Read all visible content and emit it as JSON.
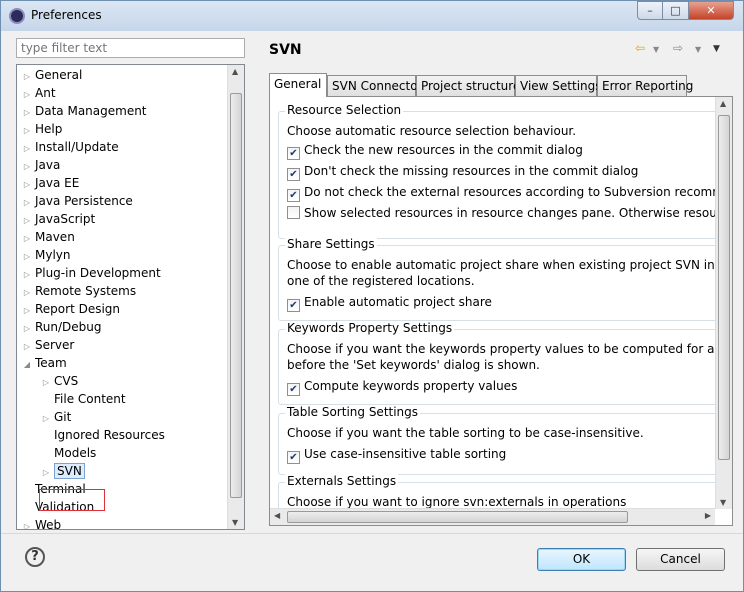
{
  "window": {
    "title": "Preferences",
    "min_label": "–",
    "max_label": "□",
    "close_label": "✕"
  },
  "filter": {
    "placeholder": "type filter text"
  },
  "tree": [
    {
      "label": "General",
      "level": 0,
      "expander": "collapsed"
    },
    {
      "label": "Ant",
      "level": 0,
      "expander": "collapsed"
    },
    {
      "label": "Data Management",
      "level": 0,
      "expander": "collapsed"
    },
    {
      "label": "Help",
      "level": 0,
      "expander": "collapsed"
    },
    {
      "label": "Install/Update",
      "level": 0,
      "expander": "collapsed"
    },
    {
      "label": "Java",
      "level": 0,
      "expander": "collapsed"
    },
    {
      "label": "Java EE",
      "level": 0,
      "expander": "collapsed"
    },
    {
      "label": "Java Persistence",
      "level": 0,
      "expander": "collapsed"
    },
    {
      "label": "JavaScript",
      "level": 0,
      "expander": "collapsed"
    },
    {
      "label": "Maven",
      "level": 0,
      "expander": "collapsed"
    },
    {
      "label": "Mylyn",
      "level": 0,
      "expander": "collapsed"
    },
    {
      "label": "Plug-in Development",
      "level": 0,
      "expander": "collapsed"
    },
    {
      "label": "Remote Systems",
      "level": 0,
      "expander": "collapsed"
    },
    {
      "label": "Report Design",
      "level": 0,
      "expander": "collapsed"
    },
    {
      "label": "Run/Debug",
      "level": 0,
      "expander": "collapsed"
    },
    {
      "label": "Server",
      "level": 0,
      "expander": "collapsed"
    },
    {
      "label": "Team",
      "level": 0,
      "expander": "expanded"
    },
    {
      "label": "CVS",
      "level": 1,
      "expander": "collapsed"
    },
    {
      "label": "File Content",
      "level": 1,
      "expander": "none"
    },
    {
      "label": "Git",
      "level": 1,
      "expander": "collapsed"
    },
    {
      "label": "Ignored Resources",
      "level": 1,
      "expander": "none"
    },
    {
      "label": "Models",
      "level": 1,
      "expander": "none"
    },
    {
      "label": "SVN",
      "level": 1,
      "expander": "collapsed",
      "selected": true
    },
    {
      "label": "Terminal",
      "level": 0,
      "expander": "none"
    },
    {
      "label": "Validation",
      "level": 0,
      "expander": "none"
    },
    {
      "label": "Web",
      "level": 0,
      "expander": "collapsed"
    }
  ],
  "page": {
    "title": "SVN"
  },
  "tabs": [
    "General",
    "SVN Connector",
    "Project structure",
    "View Settings",
    "Error Reporting"
  ],
  "general": {
    "resource_selection": {
      "title": "Resource Selection",
      "desc": "Choose automatic resource selection behaviour.",
      "options": [
        {
          "label": "Check the new resources in the commit dialog",
          "checked": true
        },
        {
          "label": "Don't check the missing resources in the commit dialog",
          "checked": true
        },
        {
          "label": "Do not check the external resources according to Subversion recommendation",
          "checked": true
        },
        {
          "label": "Show selected resources in resource changes pane. Otherwise resources are sho",
          "checked": false
        }
      ]
    },
    "share": {
      "title": "Share Settings",
      "desc1": "Choose to enable automatic project share when existing project SVN info correspo",
      "desc2": "one of the registered locations.",
      "option": {
        "label": "Enable automatic project share",
        "checked": true
      }
    },
    "keywords": {
      "title": "Keywords Property Settings",
      "desc1": "Choose if you want the keywords property values to be computed for all resource",
      "desc2": "before the 'Set keywords' dialog is shown.",
      "option": {
        "label": "Compute keywords property values",
        "checked": true
      }
    },
    "sorting": {
      "title": "Table Sorting Settings",
      "desc": "Choose if you want the table sorting to be case-insensitive.",
      "option": {
        "label": "Use case-insensitive table sorting",
        "checked": true
      }
    },
    "externals": {
      "title": "Externals Settings",
      "desc": "Choose if you want to ignore svn:externals in operations"
    }
  },
  "buttons": {
    "help": "?",
    "ok": "OK",
    "cancel": "Cancel"
  },
  "colors": {
    "svn_highlight": "#e0303a",
    "ok_border": "#3c7fb1"
  }
}
